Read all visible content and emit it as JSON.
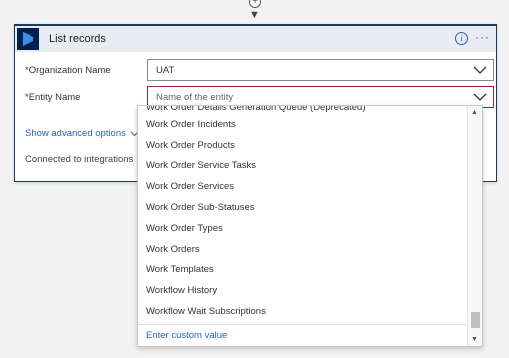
{
  "connector": {
    "add_symbol": "+",
    "arrow_symbol": "▼"
  },
  "card": {
    "title": "List records",
    "info_symbol": "i",
    "more_symbol": "···",
    "fields": {
      "organization": {
        "label": "Organization Name",
        "required_mark": "*",
        "value": "UAT"
      },
      "entity": {
        "label": "Entity Name",
        "required_mark": "*",
        "placeholder": "Name of the entity"
      }
    },
    "advanced_link": "Show advanced options",
    "connected_text": "Connected to integrations"
  },
  "dropdown": {
    "items": [
      "Work Order Details Generation Queue (Deprecated)",
      "Work Order Incidents",
      "Work Order Products",
      "Work Order Service Tasks",
      "Work Order Services",
      "Work Order Sub-Statuses",
      "Work Order Types",
      "Work Orders",
      "Work Templates",
      "Workflow History",
      "Workflow Wait Subscriptions"
    ],
    "custom_value": "Enter custom value"
  },
  "colors": {
    "accent": "#1f3b5b",
    "link": "#2a62b8",
    "required": "#cc0000",
    "error_border": "#a4262c"
  }
}
